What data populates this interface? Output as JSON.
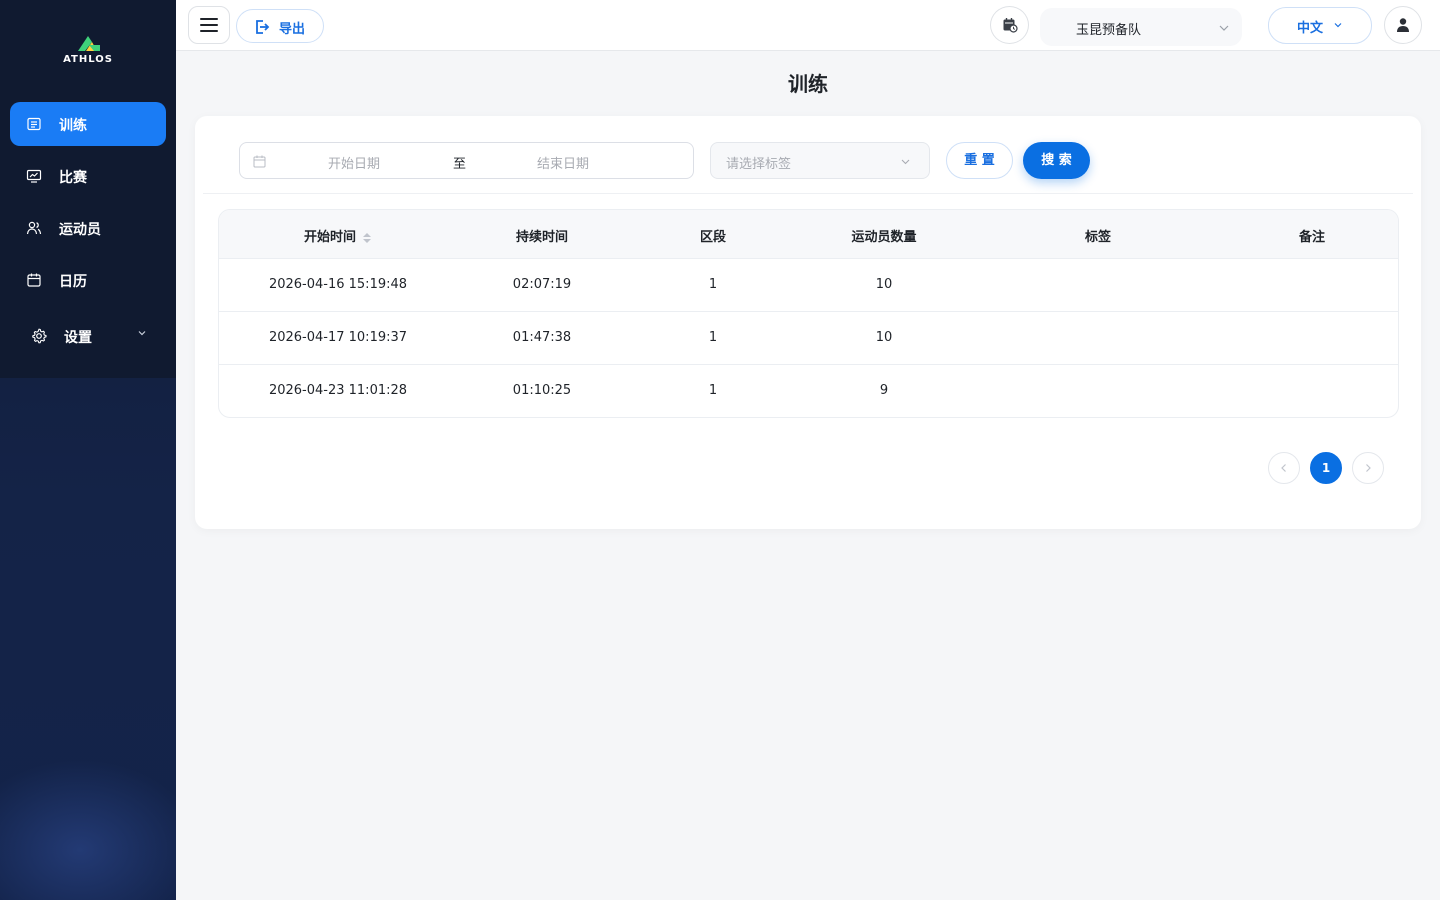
{
  "brand": {
    "logo_text": "ATHLOS",
    "accent": "#1a7cf5"
  },
  "sidebar": {
    "items": [
      {
        "label": "训练",
        "icon": "list-icon",
        "active": true
      },
      {
        "label": "比赛",
        "icon": "monitor-chart-icon",
        "active": false
      },
      {
        "label": "运动员",
        "icon": "users-icon",
        "active": false
      },
      {
        "label": "日历",
        "icon": "calendar-icon",
        "active": false
      },
      {
        "label": "设置",
        "icon": "gear-icon",
        "active": false,
        "expandable": true
      }
    ]
  },
  "header": {
    "export_label": "导出",
    "team": "玉昆预备队",
    "language": "中文"
  },
  "page": {
    "title": "训练"
  },
  "filters": {
    "start_placeholder": "开始日期",
    "range_separator": "至",
    "end_placeholder": "结束日期",
    "tag_placeholder": "请选择标签",
    "reset_label": "重 置",
    "search_label": "搜 索"
  },
  "table": {
    "headers": [
      "开始时间",
      "持续时间",
      "区段",
      "运动员数量",
      "标签",
      "备注"
    ],
    "rows": [
      [
        "2026-04-16 15:19:48",
        "02:07:19",
        "1",
        "10",
        "",
        ""
      ],
      [
        "2026-04-17 10:19:37",
        "01:47:38",
        "1",
        "10",
        "",
        ""
      ],
      [
        "2026-04-23 11:01:28",
        "01:10:25",
        "1",
        "9",
        "",
        ""
      ]
    ]
  },
  "pagination": {
    "current": "1"
  }
}
